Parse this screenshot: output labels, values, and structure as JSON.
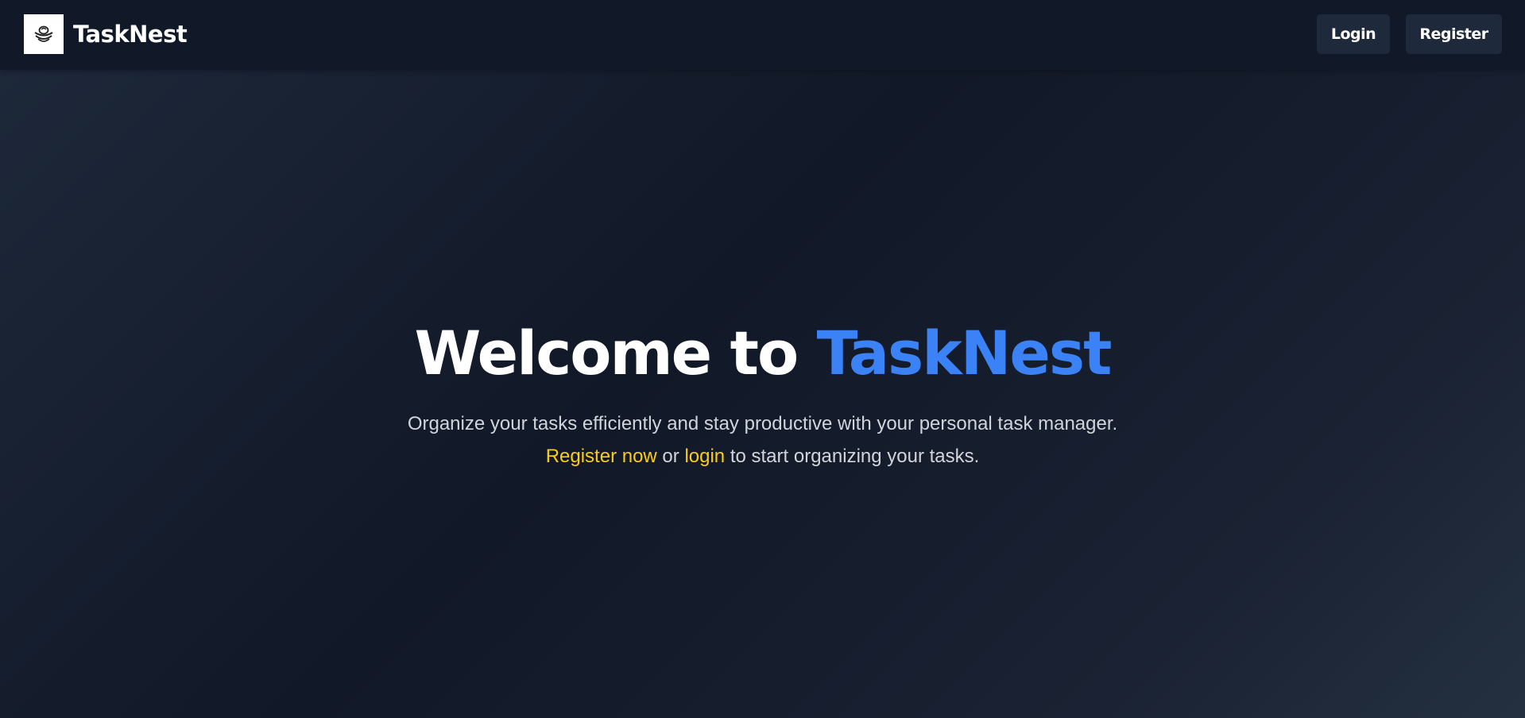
{
  "app": {
    "brand_name": "TaskNest",
    "logo_icon": "nest-icon"
  },
  "nav": {
    "login_label": "Login",
    "register_label": "Register"
  },
  "hero": {
    "title_prefix": "Welcome to ",
    "title_accent": "TaskNest",
    "subtitle_line1": "Organize your tasks efficiently and stay productive with your personal task manager.",
    "register_link": "Register now",
    "or_text": " or ",
    "login_link": "login",
    "line2_suffix": " to start organizing your tasks."
  },
  "colors": {
    "background": "#111827",
    "accent": "#3b82f6",
    "link": "#facc15",
    "button_bg": "#1e293b"
  }
}
